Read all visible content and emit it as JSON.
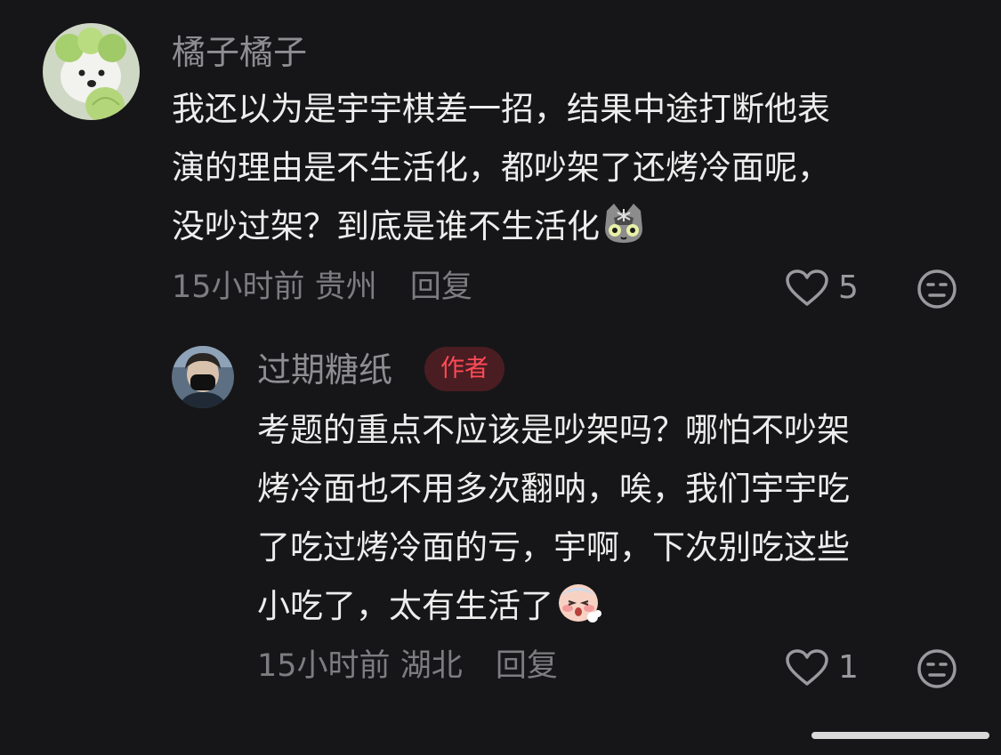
{
  "comments": [
    {
      "username": "橘子橘子",
      "lines": [
        "我还以为是宇宇棋差一招，结果中途打断他表",
        "演的理由是不生活化，都吵架了还烤冷面呢，",
        "没吵过架？到底是谁不生活化"
      ],
      "emoji": "cat-face-emoji",
      "time": "15小时前",
      "location": "贵州",
      "reply_label": "回复",
      "likes": "5"
    },
    {
      "username": "过期糖纸",
      "badge": "作者",
      "lines": [
        "考题的重点不应该是吵架吗？哪怕不吵架",
        "烤冷面也不用多次翻呐，唉，我们宇宇吃",
        "了吃过烤冷面的亏，宇啊，下次别吃这些",
        "小吃了，太有生活了"
      ],
      "emoji": "sick-face-emoji",
      "time": "15小时前",
      "location": "湖北",
      "reply_label": "回复",
      "likes": "1"
    }
  ],
  "colors": {
    "background": "#161618",
    "badge_text": "#ff4b57",
    "badge_bg": "#4a1d22"
  }
}
